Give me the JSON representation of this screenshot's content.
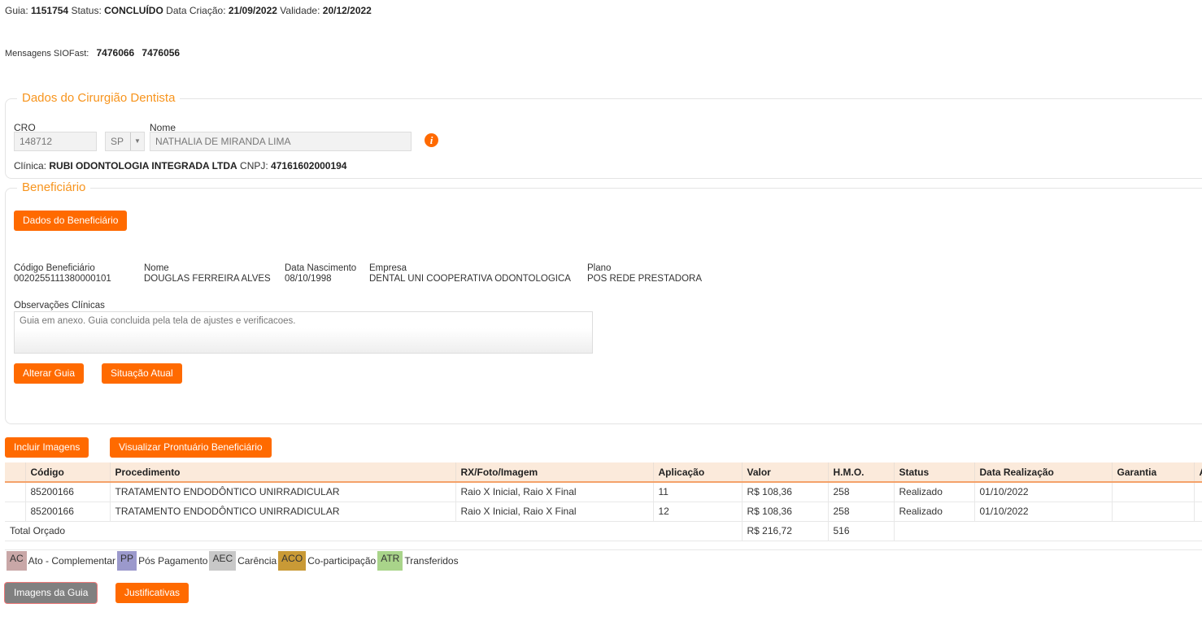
{
  "header": {
    "guia_label": "Guia:",
    "guia": "1151754",
    "status_label": "Status:",
    "status": "CONCLUÍDO",
    "criacao_label": "Data Criação:",
    "criacao": "21/09/2022",
    "validade_label": "Validade:",
    "validade": "20/12/2022",
    "siofast_label": "Mensagens SIOFast:",
    "siofast": [
      "7476066",
      "7476056"
    ]
  },
  "dentista": {
    "legend": "Dados do Cirurgião Dentista",
    "cro_label": "CRO",
    "cro": "148712",
    "uf": "SP",
    "nome_label": "Nome",
    "nome": "NATHALIA DE MIRANDA LIMA",
    "clinica_label": "Clínica:",
    "clinica": "RUBI ODONTOLOGIA INTEGRADA LTDA",
    "cnpj_label": "CNPJ:",
    "cnpj": "47161602000194"
  },
  "beneficiario": {
    "legend": "Beneficiário",
    "dados_button": "Dados do Beneficiário",
    "fields": [
      {
        "label": "Código Beneficiário",
        "value": "0020255111380000101"
      },
      {
        "label": "Nome",
        "value": "DOUGLAS FERREIRA ALVES"
      },
      {
        "label": "Data Nascimento",
        "value": "08/10/1998"
      },
      {
        "label": "Empresa",
        "value": "DENTAL UNI COOPERATIVA ODONTOLOGICA"
      },
      {
        "label": "Plano",
        "value": "POS REDE PRESTADORA"
      }
    ],
    "obs_label": "Observações Clínicas",
    "obs": "Guia em anexo. Guia concluida pela tela de ajustes e verificacoes.",
    "alterar_button": "Alterar Guia",
    "situacao_button": "Situação Atual"
  },
  "actions": {
    "incluir": "Incluir Imagens",
    "prontuario": "Visualizar Prontuário Beneficiário",
    "imagens": "Imagens da Guia",
    "justificativas": "Justificativas"
  },
  "table": {
    "headers": [
      "",
      "Código",
      "Procedimento",
      "RX/Foto/Imagem",
      "Aplicação",
      "Valor",
      "H.M.O.",
      "Status",
      "Data Realização",
      "Garantia",
      "A"
    ],
    "rows": [
      [
        "",
        "85200166",
        "TRATAMENTO ENDODÔNTICO UNIRRADICULAR",
        "Raio X Inicial, Raio X Final",
        "11",
        "R$ 108,36",
        "258",
        "Realizado",
        "01/10/2022",
        "",
        ""
      ],
      [
        "",
        "85200166",
        "TRATAMENTO ENDODÔNTICO UNIRRADICULAR",
        "Raio X Inicial, Raio X Final",
        "12",
        "R$ 108,36",
        "258",
        "Realizado",
        "01/10/2022",
        "",
        ""
      ]
    ],
    "total_label": "Total Orçado",
    "total_valor": "R$ 216,72",
    "total_hmo": "516"
  },
  "legend_items": [
    {
      "code": "AC",
      "label": "Ato - Complementar",
      "color": "#c9a7a7"
    },
    {
      "code": "PP",
      "label": "Pós Pagamento",
      "color": "#9b99cc"
    },
    {
      "code": "AEC",
      "label": "Carência",
      "color": "#c8c8c8"
    },
    {
      "code": "ACO",
      "label": "Co-participação",
      "color": "#c99a36"
    },
    {
      "code": "ATR",
      "label": "Transferidos",
      "color": "#a9d48a"
    }
  ],
  "colors": {
    "accent": "#ff6a00",
    "legend_text": "#f7941d"
  }
}
